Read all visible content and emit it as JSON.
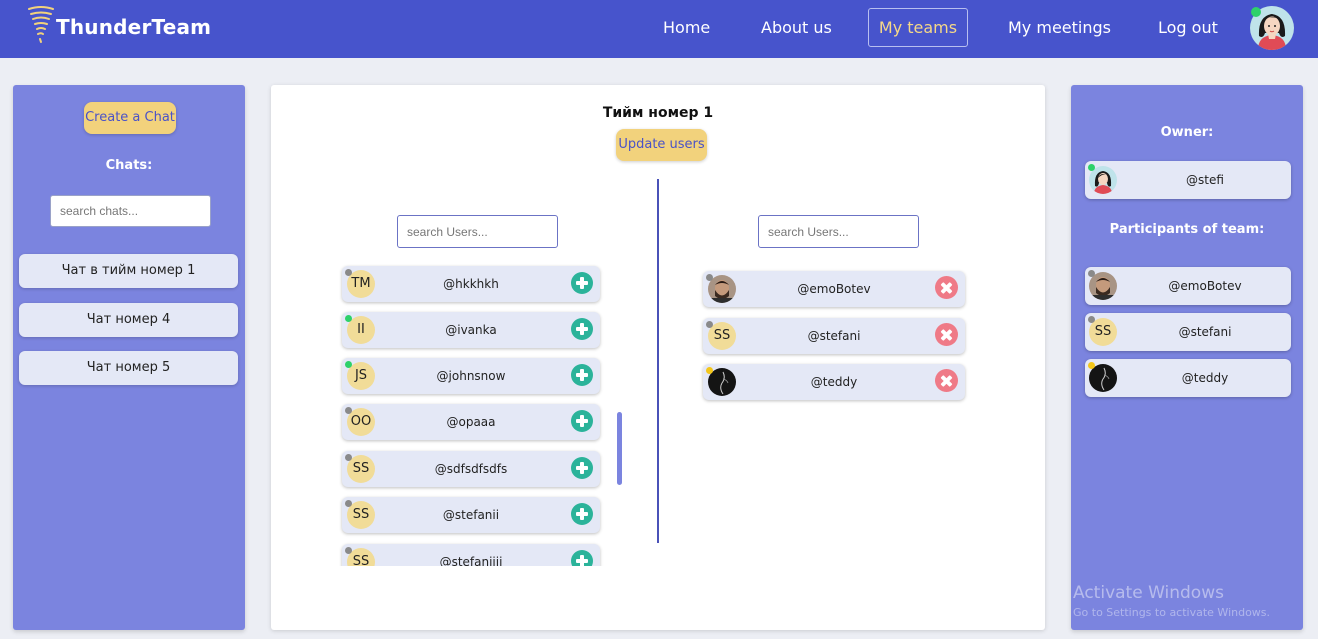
{
  "navbar": {
    "brand": "ThunderTeam",
    "links": {
      "home": "Home",
      "about": "About us",
      "my_teams": "My teams",
      "my_meetings": "My meetings",
      "logout": "Log out"
    },
    "icons": {
      "logo": "tornado-icon",
      "avatar": "user-avatar"
    }
  },
  "sidebar": {
    "create_chat": "Create a Chat",
    "chats_heading": "Chats:",
    "search_placeholder": "search chats...",
    "chats": [
      "Чат в тийм номер 1",
      "Чат номер 4",
      "Чат номер 5"
    ]
  },
  "team": {
    "title": "Тийм номер 1",
    "update_button": "Update users",
    "available": {
      "search_placeholder": "search Users...",
      "users": [
        {
          "initials": "TM",
          "username": "@hkkhkh"
        },
        {
          "initials": "II",
          "username": "@ivanka"
        },
        {
          "initials": "JS",
          "username": "@johnsnow"
        },
        {
          "initials": "OO",
          "username": "@opaaa"
        },
        {
          "initials": "SS",
          "username": "@sdfsdfsdfs"
        },
        {
          "initials": "SS",
          "username": "@stefanii"
        },
        {
          "initials": "SS",
          "username": "@stefaniiii"
        }
      ]
    },
    "members": {
      "search_placeholder": "search Users...",
      "users": [
        {
          "initials": "",
          "username": "@emoBotev"
        },
        {
          "initials": "SS",
          "username": "@stefani"
        },
        {
          "initials": "",
          "username": "@teddy"
        }
      ]
    }
  },
  "info": {
    "owner_heading": "Owner:",
    "owner": "@stefi",
    "participants_heading": "Participants of team:",
    "participants": [
      {
        "initials": "",
        "username": "@emoBotev"
      },
      {
        "initials": "SS",
        "username": "@stefani"
      },
      {
        "initials": "",
        "username": "@teddy"
      }
    ]
  },
  "watermark": {
    "title": "Activate Windows",
    "subtitle": "Go to Settings to activate Windows."
  },
  "colors": {
    "navbar": "#4754cc",
    "panel": "#7b84df",
    "accent_yellow": "#f2d27c",
    "add": "#2bb39a",
    "remove": "#ef7a87",
    "online": "#2ed16a",
    "offline": "#8a8a8a",
    "away": "#f3c61a"
  }
}
